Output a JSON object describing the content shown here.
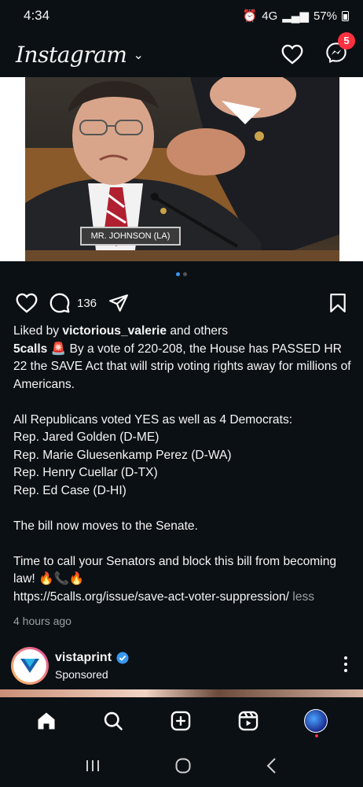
{
  "status_bar": {
    "time": "4:34",
    "network": "4G",
    "battery": "57%"
  },
  "header": {
    "logo": "Instagram",
    "messages_badge": "5"
  },
  "post": {
    "image": {
      "nameplate": "MR. JOHNSON (LA)"
    },
    "carousel": {
      "total": 2,
      "active": 1
    },
    "comment_count": "136",
    "liked_by_prefix": "Liked by ",
    "liked_by_user": "victorious_valerie",
    "liked_by_suffix": " and others",
    "author": "5calls",
    "caption_lines": [
      "🚨 By a vote of 220-208, the House has PASSED HR 22 the SAVE Act that will strip voting rights away for millions of Americans.",
      "",
      "All Republicans voted YES as well as 4 Democrats:",
      "Rep. Jared Golden (D-ME)",
      "Rep. Marie Gluesenkamp Perez (D-WA)",
      "Rep. Henry Cuellar (D-TX)",
      "Rep. Ed Case (D-HI)",
      "",
      "The bill now moves to the Senate.",
      "",
      "Time to call your Senators and block this bill from becoming law! 🔥📞🔥"
    ],
    "link": "https://5calls.org/issue/save-act-voter-suppression/",
    "less_label": "less",
    "timestamp": "4 hours ago"
  },
  "sponsored_post": {
    "account": "vistaprint",
    "label": "Sponsored"
  },
  "colors": {
    "badge": "#ff3040",
    "verified": "#3897f0",
    "active_dot": "#3897f0"
  }
}
